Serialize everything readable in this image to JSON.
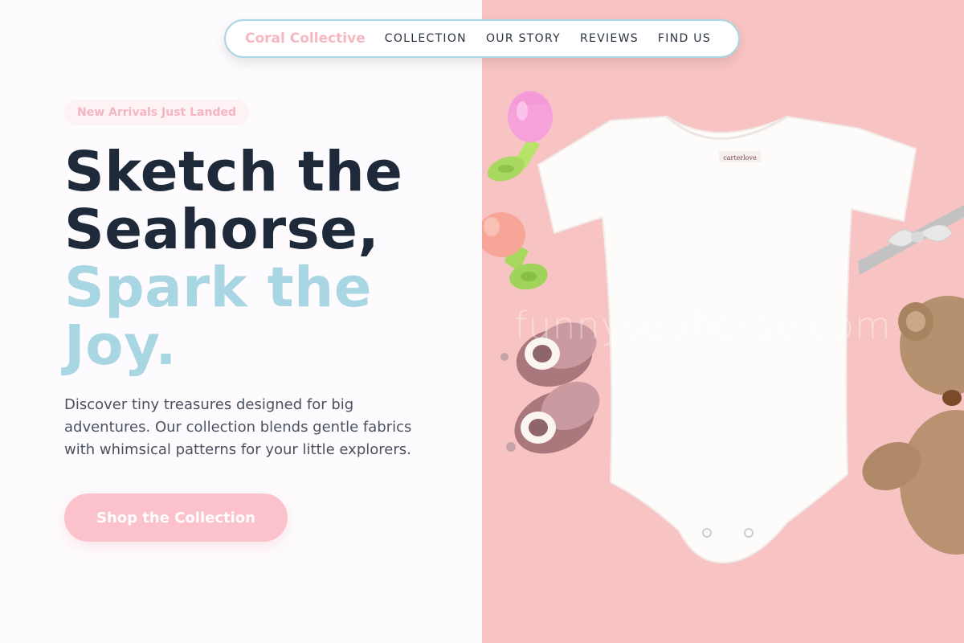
{
  "nav": {
    "brand": "Coral Collective",
    "links": [
      "COLLECTION",
      "OUR STORY",
      "REVIEWS",
      "FIND US"
    ]
  },
  "hero": {
    "badge": "New Arrivals Just Landed",
    "headline_line1": "Sketch the",
    "headline_line2": "Seahorse,",
    "headline_line3": "Spark the",
    "headline_line4": "Joy.",
    "description": "Discover tiny treasures designed for big adventures. Our collection blends gentle fabrics with whimsical patterns for your little explorers.",
    "cta_label": "Shop the Collection"
  },
  "image": {
    "watermark": "funnyseahorse.com",
    "onesie_tag": "carterlove"
  },
  "colors": {
    "brand_pink": "#f6b6c2",
    "accent_blue": "#a9d6e3",
    "dark_text": "#1e2a3a",
    "cta_pink": "#fbc2cb",
    "photo_background": "#f8c4c3"
  },
  "icons": [
    "teether-icon",
    "baby-bootie-icon",
    "teddy-bear-icon",
    "bow-headband-icon"
  ]
}
